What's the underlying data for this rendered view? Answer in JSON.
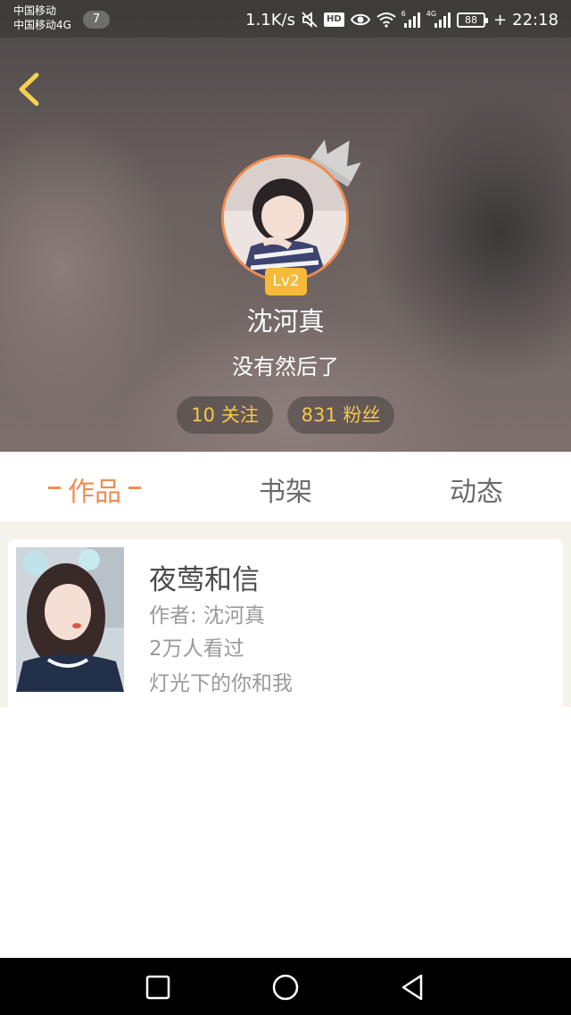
{
  "status_bar": {
    "carrier_1": "中国移动",
    "carrier_2": "中国移动4G",
    "notification_count": "7",
    "speed": "1.1K/s",
    "hd_label": "HD",
    "signal_1_label": "6",
    "signal_2_label": "4G",
    "battery": "88",
    "time": "22:18"
  },
  "profile": {
    "level": "Lv2",
    "name": "沈河真",
    "signature": "没有然后了",
    "following": "10 关注",
    "fans": "831 粉丝"
  },
  "tabs": [
    {
      "label": "作品",
      "active": true
    },
    {
      "label": "书架",
      "active": false
    },
    {
      "label": "动态",
      "active": false
    }
  ],
  "works": [
    {
      "title": "夜莺和信",
      "author": "作者: 沈河真",
      "views": "2万人看过",
      "description": "灯光下的你和我"
    }
  ],
  "colors": {
    "accent": "#ef8d52",
    "level_badge": "#f6b93a",
    "stat_text": "#f5c84b",
    "avatar_ring": "#f08a4b"
  },
  "icons": {
    "back": "chevron-left-icon",
    "crown": "crown-icon",
    "nav_recent": "square-icon",
    "nav_home": "circle-icon",
    "nav_back": "triangle-back-icon"
  }
}
